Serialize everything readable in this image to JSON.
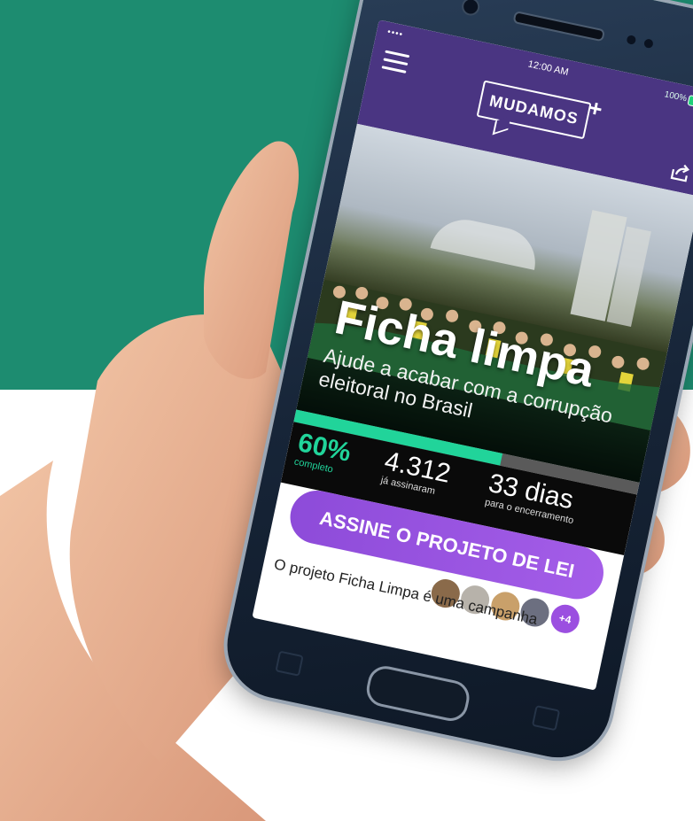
{
  "status_bar": {
    "time": "12:00 AM",
    "signal": "••••",
    "battery": "100%"
  },
  "header": {
    "logo": "MUDAMOS",
    "logo_plus": "+"
  },
  "hero": {
    "title": "Ficha limpa",
    "subtitle": "Ajude a acabar com a corrupção eleitoral no Brasil"
  },
  "progress": {
    "percent": 60
  },
  "stats": {
    "completion": {
      "value": "60%",
      "label": "completo"
    },
    "signatures": {
      "value": "4.312",
      "label": "já assinaram"
    },
    "days_left": {
      "value": "33 dias",
      "label": "para o encerramento"
    }
  },
  "cta": {
    "label": "ASSINE O PROJETO DE LEI"
  },
  "description": {
    "text": "O projeto Ficha Limpa é uma campanha"
  },
  "supporters": {
    "more_count": "+4"
  },
  "colors": {
    "background_band": "#1d8c70",
    "header_purple": "#4a3582",
    "accent_green": "#21d49a",
    "cta_purple": "#9b4fe0"
  },
  "icons": [
    "menu-icon",
    "share-icon",
    "home-button"
  ]
}
